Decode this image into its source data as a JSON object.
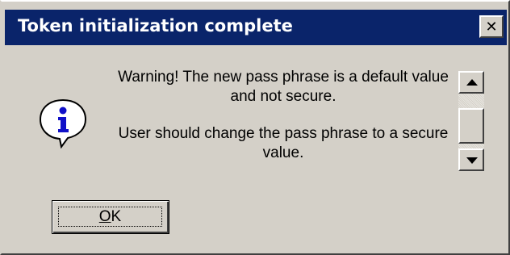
{
  "dialog": {
    "title": "Token initialization complete",
    "close_glyph": "✕",
    "icon": "info-icon",
    "messages": [
      "Warning! The new pass phrase is a default value and not secure.",
      "User should change the pass phrase to a secure value."
    ],
    "ok_button": {
      "mnemonic": "O",
      "rest": "K"
    }
  },
  "colors": {
    "titlebar": "#0a246a",
    "face": "#d4d0c8",
    "info_blue": "#1010c8"
  }
}
